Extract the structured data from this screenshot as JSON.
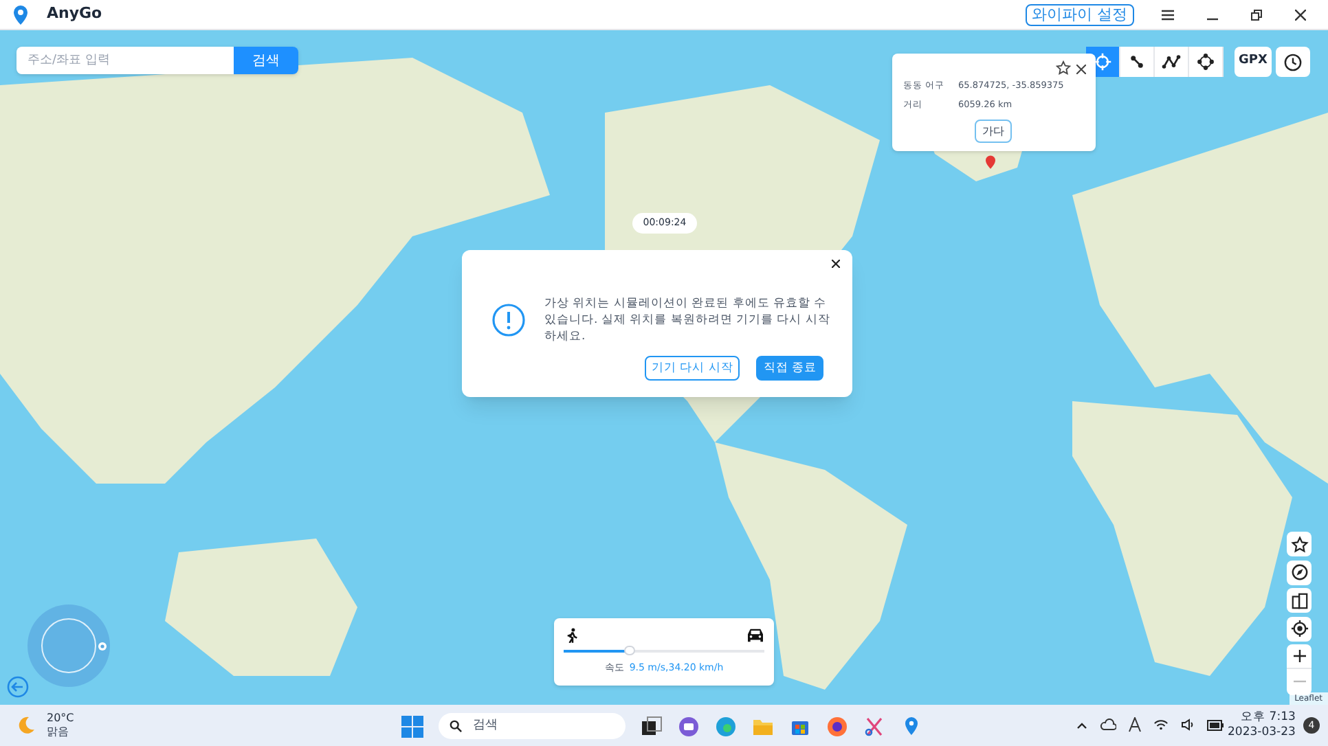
{
  "window": {
    "title": "AnyGo",
    "wifi_button": "와이파이 설정"
  },
  "search": {
    "placeholder": "주소/좌표 입력",
    "button": "검색"
  },
  "mode_buttons": [
    {
      "kind": "teleport",
      "selected": true
    },
    {
      "kind": "two-spot",
      "selected": false
    },
    {
      "kind": "multi-spot",
      "selected": false
    },
    {
      "kind": "joystick",
      "selected": false
    }
  ],
  "gpx_button": "GPX",
  "popup": {
    "rows": [
      {
        "label": "동동 어구",
        "value": "65.874725, -35.859375"
      },
      {
        "label": "거리",
        "value": "6059.26 km"
      }
    ],
    "go_button": "가다"
  },
  "timer": "00:09:24",
  "dialog": {
    "message": "가상 위치는 시뮬레이션이 완료된 후에도 유효할 수 있습니다. 실제 위치를 복원하려면 기기를 다시 시작하세요.",
    "buttons": [
      {
        "label": "기기 다시 시작",
        "kind": "outline"
      },
      {
        "label": "직접 종료",
        "kind": "primary"
      }
    ]
  },
  "speed_panel": {
    "level": 0.33,
    "label": "속도",
    "value": "9.5 m/s,34.20 km/h"
  },
  "zoom_out_disabled": true,
  "attribution": "Leaflet",
  "taskbar": {
    "temperature": "20°C",
    "condition": "맑음",
    "search": "검색",
    "time": "오후 7:13",
    "date": "2023-03-23",
    "notifications": "4"
  }
}
